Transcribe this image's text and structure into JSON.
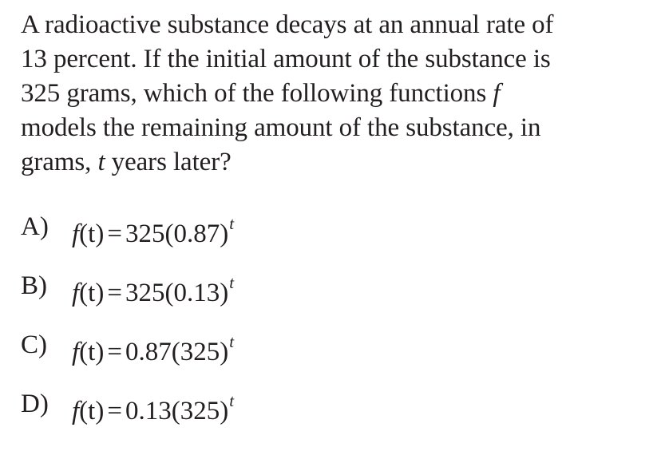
{
  "question": {
    "lines": [
      "A radioactive substance decays at an annual rate of",
      "13 percent.  If the initial amount of the substance is",
      "325 grams, which of the following functions ",
      "models the remaining amount of the substance, in",
      "grams, "
    ],
    "function_var": "f",
    "time_var": "t",
    "tail": " years later?"
  },
  "choices": [
    {
      "letter": "A)",
      "fn": "f",
      "arg": "(t)",
      "eq": "=",
      "base": "325(0.87)",
      "exp": "t"
    },
    {
      "letter": "B)",
      "fn": "f",
      "arg": "(t)",
      "eq": "=",
      "base": "325(0.13)",
      "exp": "t"
    },
    {
      "letter": "C)",
      "fn": "f",
      "arg": "(t)",
      "eq": "=",
      "base": "0.87(325)",
      "exp": "t"
    },
    {
      "letter": "D)",
      "fn": "f",
      "arg": "(t)",
      "eq": "=",
      "base": "0.13(325)",
      "exp": "t"
    }
  ]
}
